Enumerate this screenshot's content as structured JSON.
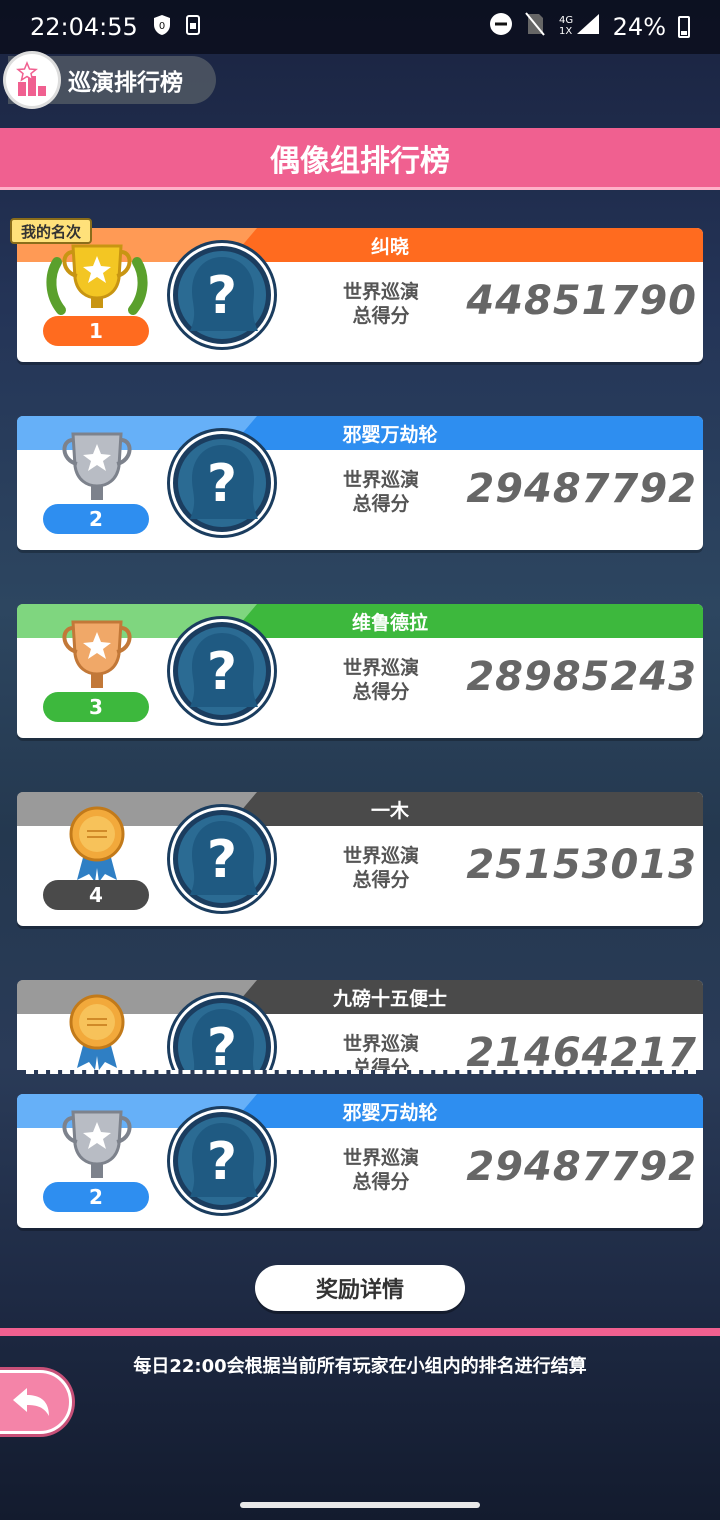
{
  "status_bar": {
    "time": "22:04:55",
    "network": "4G\n1X",
    "battery": "24%"
  },
  "header": {
    "tour_ranking_label": "巡演排行榜",
    "title": "偶像组排行榜"
  },
  "my_rank_tag": "我的名次",
  "score_label_line1": "世界巡演",
  "score_label_line2": "总得分",
  "entries": [
    {
      "rank": "1",
      "name": "纠晓",
      "score": "44851790",
      "color": "#ff6b1f",
      "color_light": "#ff9a55",
      "trophy": "gold-trophy"
    },
    {
      "rank": "2",
      "name": "邪婴万劫轮",
      "score": "29487792",
      "color": "#2e8ef0",
      "color_light": "#66b0f8",
      "trophy": "silver-trophy"
    },
    {
      "rank": "3",
      "name": "维鲁德拉",
      "score": "28985243",
      "color": "#3db83d",
      "color_light": "#7fd67f",
      "trophy": "bronze-trophy"
    },
    {
      "rank": "4",
      "name": "一木",
      "score": "25153013",
      "color": "#4a4a4a",
      "color_light": "#9a9a9a",
      "trophy": "medal"
    },
    {
      "rank": "",
      "name": "九磅十五便士",
      "score": "21464217",
      "color": "#4a4a4a",
      "color_light": "#9a9a9a",
      "trophy": "medal"
    }
  ],
  "my_entry": {
    "rank": "2",
    "name": "邪婴万劫轮",
    "score": "29487792",
    "color": "#2e8ef0",
    "color_light": "#66b0f8",
    "trophy": "silver-trophy"
  },
  "reward_button": "奖励详情",
  "footer_note": "每日22:00会根据当前所有玩家在小组内的排名进行结算",
  "colors": {
    "accent_pink": "#f06090"
  }
}
